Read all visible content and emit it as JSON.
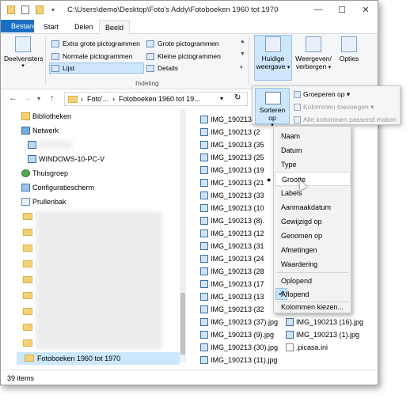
{
  "titlebar": {
    "path": "C:\\Users\\demo\\Desktop\\Foto's Addy\\Fotoboeken 1960 tot 1970",
    "minimize": "—",
    "maximize": "☐",
    "close": "✕"
  },
  "tabs": [
    "Bestand",
    "Start",
    "Delen",
    "Beeld"
  ],
  "ribbon": {
    "panes_label": "Deelvensters",
    "layout": {
      "extra_large": "Extra grote pictogrammen",
      "large": "Grote pictogrammen",
      "medium": "Normale pictogrammen",
      "small": "Kleine pictogrammen",
      "list": "Lijst",
      "details": "Details",
      "group": "Indeling"
    },
    "current_view": "Huidige weergave",
    "show_hide": "Weergeven/ verbergen",
    "options": "Opties"
  },
  "address": {
    "crumb1": "Foto'...",
    "crumb2": "Fotoboeken 1960 tot 19..."
  },
  "nav_tree": [
    {
      "label": "Bibliotheken",
      "icon": "library-icon"
    },
    {
      "label": "Netwerk",
      "icon": "network-icon"
    },
    {
      "label": "",
      "icon": "computer-icon"
    },
    {
      "label": "WINDOWS-10-PC-V",
      "icon": "computer-icon"
    },
    {
      "label": "Thuisgroep",
      "icon": "homegroup-icon"
    },
    {
      "label": "Configuratiescherm",
      "icon": "control-panel-icon"
    },
    {
      "label": "Prullenbak",
      "icon": "recycle-bin-icon"
    }
  ],
  "selected_folder": "Fotoboeken 1960 tot 1970",
  "files_col1": [
    "IMG_190213 (2",
    "IMG_190213 (2",
    "IMG_190213 (35",
    "IMG_190213 (25",
    "IMG_190213 (19",
    "IMG_190213 (21",
    "IMG_190213 (33",
    "IMG_190213 (10",
    "IMG_190213 (8).",
    "IMG_190213 (12",
    "IMG_190213 (31",
    "IMG_190213 (24",
    "IMG_190213 (28",
    "IMG_190213 (17",
    "IMG_190213 (13",
    "IMG_190213 (32",
    "IMG_190213 (37).jpg",
    "IMG_190213 (9).jpg",
    "IMG_190213 (30).jpg",
    "IMG_190213 (11).jpg"
  ],
  "files_col2": [
    "IMG_190213 (16).jpg",
    "IMG_190213 (1).jpg",
    ".picasa.ini"
  ],
  "sort_popup": {
    "sort_by": "Sorteren op",
    "group_by": "Groeperen op",
    "add_columns": "Kolommen toevoegen",
    "fit_columns": "Alle kolommen passend maken"
  },
  "sort_menu": {
    "items": [
      "Naam",
      "Datum",
      "Type",
      "Grootte",
      "Labels",
      "Aanmaakdatum",
      "Gewijzigd op",
      "Genomen op",
      "Afmetingen",
      "Waardering"
    ],
    "selected": "Grootte",
    "ascending": "Oplopend",
    "descending": "Aflopend",
    "choose_columns": "Kolommen kiezen..."
  },
  "status": {
    "count": "39 items"
  },
  "colors": {
    "file_tab": "#1a6fc4",
    "highlight": "#cde6fb",
    "folder": "#f4d175"
  }
}
